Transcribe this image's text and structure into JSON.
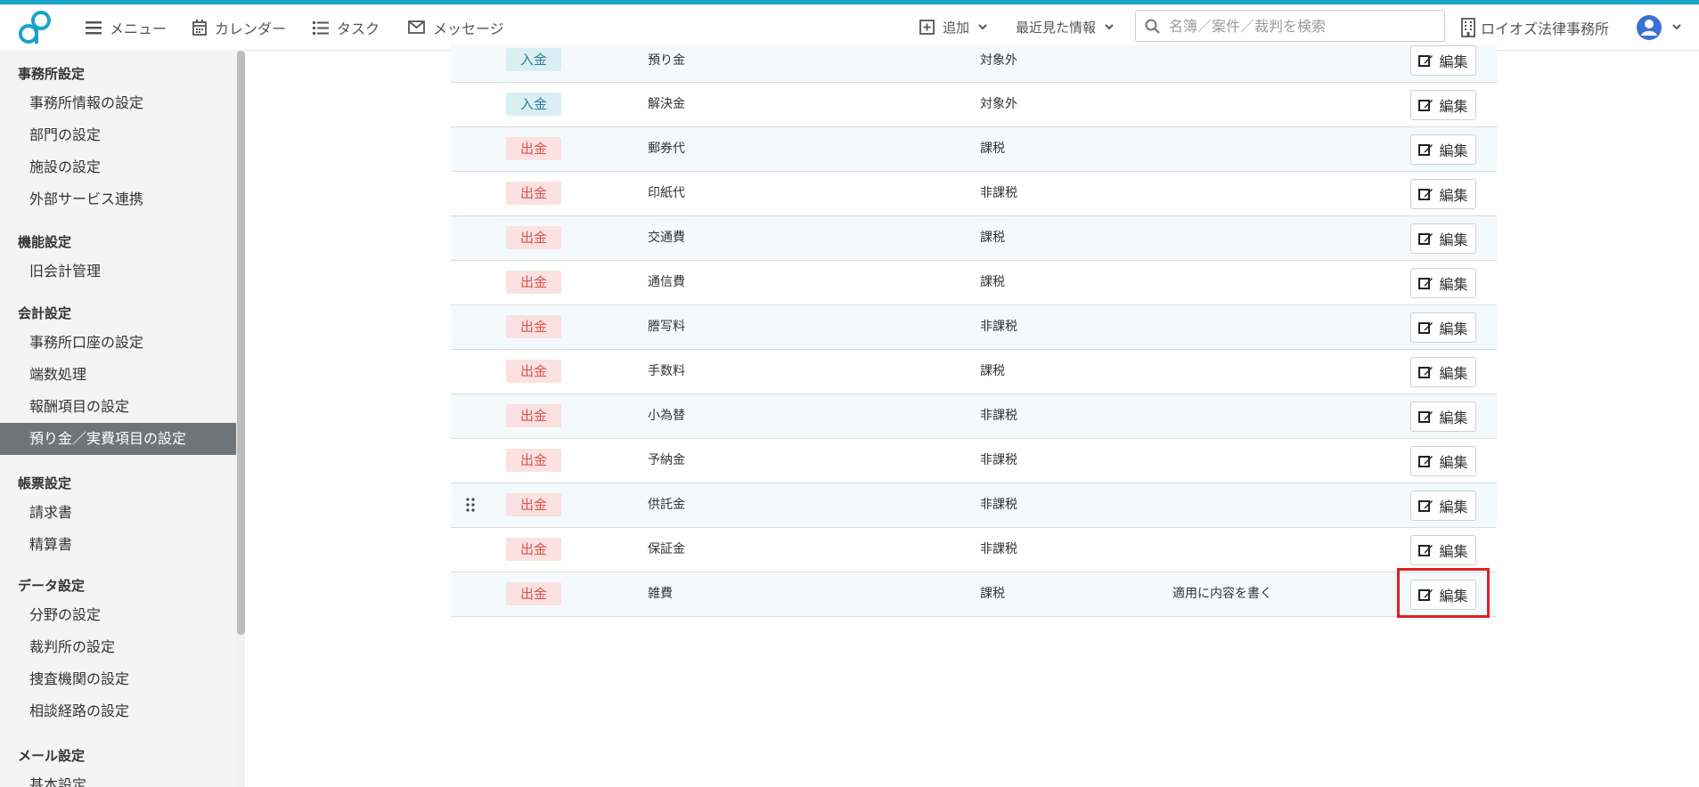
{
  "header": {
    "nav": [
      "メニュー",
      "カレンダー",
      "タスク",
      "メッセージ"
    ],
    "add_label": "追加",
    "recent_label": "最近見た情報",
    "search_placeholder": "名簿／案件／裁判を検索",
    "office_name": "ロイオズ法律事務所"
  },
  "sidebar": {
    "sections": [
      {
        "title": "事務所設定",
        "items": [
          "事務所情報の設定",
          "部門の設定",
          "施設の設定",
          "外部サービス連携"
        ]
      },
      {
        "title": "機能設定",
        "items": [
          "旧会計管理"
        ]
      },
      {
        "title": "会計設定",
        "items": [
          "事務所口座の設定",
          "端数処理",
          "報酬項目の設定",
          "預り金／実費項目の設定"
        ]
      },
      {
        "title": "帳票設定",
        "items": [
          "請求書",
          "精算書"
        ]
      },
      {
        "title": "データ設定",
        "items": [
          "分野の設定",
          "裁判所の設定",
          "捜査機関の設定",
          "相談経路の設定"
        ]
      },
      {
        "title": "メール設定",
        "items": [
          "基本設定"
        ]
      }
    ],
    "active_item": "預り金／実費項目の設定"
  },
  "table": {
    "edit_label": "編集",
    "rows": [
      {
        "type": "入金",
        "name": "預り金",
        "tax": "対象外",
        "note": ""
      },
      {
        "type": "入金",
        "name": "解決金",
        "tax": "対象外",
        "note": ""
      },
      {
        "type": "出金",
        "name": "郵券代",
        "tax": "課税",
        "note": ""
      },
      {
        "type": "出金",
        "name": "印紙代",
        "tax": "非課税",
        "note": ""
      },
      {
        "type": "出金",
        "name": "交通費",
        "tax": "課税",
        "note": ""
      },
      {
        "type": "出金",
        "name": "通信費",
        "tax": "課税",
        "note": ""
      },
      {
        "type": "出金",
        "name": "謄写料",
        "tax": "非課税",
        "note": ""
      },
      {
        "type": "出金",
        "name": "手数料",
        "tax": "課税",
        "note": ""
      },
      {
        "type": "出金",
        "name": "小為替",
        "tax": "非課税",
        "note": ""
      },
      {
        "type": "出金",
        "name": "予納金",
        "tax": "非課税",
        "note": ""
      },
      {
        "type": "出金",
        "name": "供託金",
        "tax": "非課税",
        "note": ""
      },
      {
        "type": "出金",
        "name": "保証金",
        "tax": "非課税",
        "note": ""
      },
      {
        "type": "出金",
        "name": "雑費",
        "tax": "課税",
        "note": "適用に内容を書く"
      }
    ]
  },
  "colors": {
    "accent": "#1aa3c9",
    "deposit": "#2a7e8e",
    "withdrawal": "#d9534f",
    "highlight": "#e02020"
  }
}
